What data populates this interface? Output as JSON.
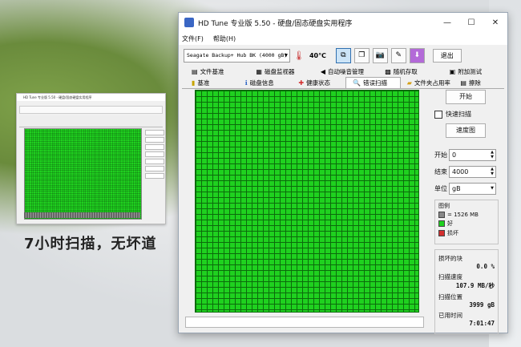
{
  "caption": "7小时扫描，无坏道",
  "window": {
    "title": "HD Tune 专业版 5.50 - 硬盘/固态硬盘实用程序",
    "menu": [
      "文件(F)",
      "帮助(H)"
    ],
    "drive": "Seagate Backup+ Hub BK (4000 gB)",
    "temperature": "40℃",
    "exit_label": "退出",
    "tabs_row1": [
      "文件基准",
      "磁盘监视器",
      "自动噪音管理",
      "随机存取",
      "附加测试"
    ],
    "tabs_row2": [
      "基准",
      "磁盘信息",
      "健康状态",
      "错误扫描",
      "文件夹占用率",
      "擦除"
    ],
    "active_tab": "错误扫描"
  },
  "side": {
    "start_button": "开始",
    "quick_scan": "快速扫描",
    "speed_map": "速度图",
    "start_label": "开始",
    "start_value": "0",
    "end_label": "结束",
    "end_value": "4000",
    "unit_label": "单位",
    "unit_value": "gB",
    "legend_title": "图例",
    "legend_block": "= 1526 MB",
    "legend_good": "好",
    "legend_bad": "损坏",
    "damaged_label": "损坏的块",
    "damaged_value": "0.0 %",
    "speed_label": "扫描速度",
    "speed_value": "107.9 MB/秒",
    "position_label": "扫描位置",
    "position_value": "3999 gB",
    "elapsed_label": "已用时间",
    "elapsed_value": "7:01:47"
  },
  "thumbnail": {
    "title": "HD Tune 专业版 5.50 - 硬盘/固态硬盘实用程序"
  },
  "colors": {
    "good": "#1fd11f",
    "bad": "#d32f2f",
    "block": "#888888"
  }
}
